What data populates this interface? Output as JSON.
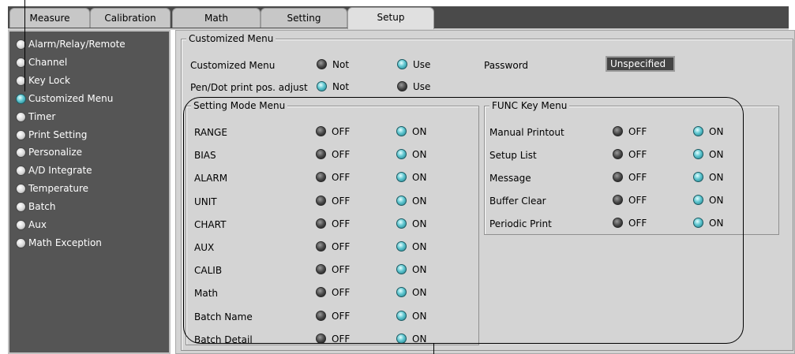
{
  "tabs": [
    "Measure",
    "Calibration",
    "Math",
    "Setting",
    "Setup"
  ],
  "active_tab": "Setup",
  "sidebar": {
    "items": [
      {
        "label": "Alarm/Relay/Remote",
        "selected": false
      },
      {
        "label": "Channel",
        "selected": false
      },
      {
        "label": "Key Lock",
        "selected": false
      },
      {
        "label": "Customized Menu",
        "selected": true
      },
      {
        "label": "Timer",
        "selected": false
      },
      {
        "label": "Print Setting",
        "selected": false
      },
      {
        "label": "Personalize",
        "selected": false
      },
      {
        "label": "A/D Integrate",
        "selected": false
      },
      {
        "label": "Temperature",
        "selected": false
      },
      {
        "label": "Batch",
        "selected": false
      },
      {
        "label": "Aux",
        "selected": false
      },
      {
        "label": "Math Exception",
        "selected": false
      }
    ]
  },
  "customized": {
    "group_title": "Customized Menu",
    "menu_label": "Customized Menu",
    "menu_opts": [
      "Not",
      "Use"
    ],
    "menu_value": "Use",
    "pen_label": "Pen/Dot print pos. adjust",
    "pen_opts": [
      "Not",
      "Use"
    ],
    "pen_value": "Not",
    "password_label": "Password",
    "password_value": "Unspecified"
  },
  "setting_mode": {
    "title": "Setting Mode Menu",
    "rows": [
      {
        "label": "RANGE",
        "value": "ON"
      },
      {
        "label": "BIAS",
        "value": "ON"
      },
      {
        "label": "ALARM",
        "value": "ON"
      },
      {
        "label": "UNIT",
        "value": "ON"
      },
      {
        "label": "CHART",
        "value": "ON"
      },
      {
        "label": "AUX",
        "value": "ON"
      },
      {
        "label": "CALIB",
        "value": "ON"
      },
      {
        "label": "Math",
        "value": "ON"
      },
      {
        "label": "Batch Name",
        "value": "ON"
      },
      {
        "label": "Batch Detail",
        "value": "ON"
      }
    ]
  },
  "func_key": {
    "title": "FUNC Key Menu",
    "rows": [
      {
        "label": "Manual Printout",
        "value": "ON"
      },
      {
        "label": "Setup List",
        "value": "ON"
      },
      {
        "label": "Message",
        "value": "ON"
      },
      {
        "label": "Buffer Clear",
        "value": "ON"
      },
      {
        "label": "Periodic Print",
        "value": "ON"
      }
    ]
  },
  "opt_labels": {
    "off": "OFF",
    "on": "ON"
  },
  "colors": {
    "led_on": "#5fc6d0",
    "led_off": "#444444",
    "sidebar_bg": "#555555",
    "panel_bg": "#d4d4d4",
    "tab_strip": "#4a4a4a"
  }
}
